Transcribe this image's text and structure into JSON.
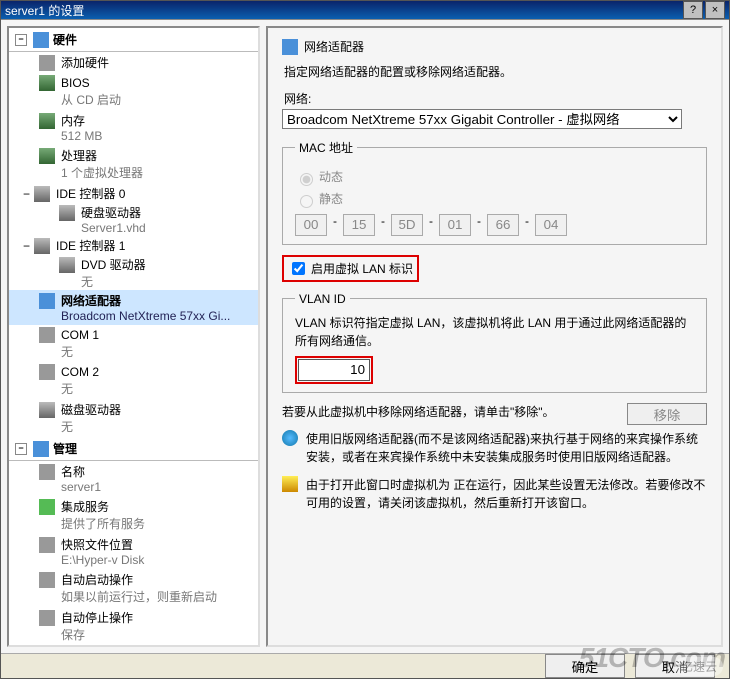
{
  "window": {
    "title": "server1 的设置"
  },
  "titlebar_buttons": {
    "help": "?",
    "close": "×"
  },
  "sections": {
    "hardware": "硬件",
    "management": "管理"
  },
  "hw_items": [
    {
      "label": "添加硬件",
      "sub": ""
    },
    {
      "label": "BIOS",
      "sub": "从 CD 启动"
    },
    {
      "label": "内存",
      "sub": "512 MB"
    },
    {
      "label": "处理器",
      "sub": "1 个虚拟处理器"
    },
    {
      "label": "IDE 控制器 0",
      "sub": "",
      "expandable": true,
      "child": {
        "label": "硬盘驱动器",
        "sub": "Server1.vhd"
      }
    },
    {
      "label": "IDE 控制器 1",
      "sub": "",
      "expandable": true,
      "child": {
        "label": "DVD 驱动器",
        "sub": "无"
      }
    },
    {
      "label": "网络适配器",
      "sub": "Broadcom NetXtreme 57xx Gi...",
      "selected": true
    },
    {
      "label": "COM 1",
      "sub": "无"
    },
    {
      "label": "COM 2",
      "sub": "无"
    },
    {
      "label": "磁盘驱动器",
      "sub": "无"
    }
  ],
  "mgmt_items": [
    {
      "label": "名称",
      "sub": "server1"
    },
    {
      "label": "集成服务",
      "sub": "提供了所有服务"
    },
    {
      "label": "快照文件位置",
      "sub": "E:\\Hyper-v Disk"
    },
    {
      "label": "自动启动操作",
      "sub": "如果以前运行过，则重新启动"
    },
    {
      "label": "自动停止操作",
      "sub": "保存"
    }
  ],
  "panel": {
    "title": "网络适配器",
    "desc": "指定网络适配器的配置或移除网络适配器。",
    "net_label": "网络:",
    "net_value": "Broadcom NetXtreme 57xx Gigabit Controller - 虚拟网络",
    "mac_legend": "MAC 地址",
    "mac_dynamic": "动态",
    "mac_static": "静态",
    "mac": [
      "00",
      "15",
      "5D",
      "01",
      "66",
      "04"
    ],
    "vlan_enable": "启用虚拟 LAN 标识",
    "vlan_legend": "VLAN ID",
    "vlan_desc": "VLAN 标识符指定虚拟 LAN，该虚拟机将此 LAN 用于通过此网络适配器的所有网络通信。",
    "vlan_value": "10",
    "remove_desc": "若要从此虚拟机中移除网络适配器，请单击\"移除\"。",
    "remove_btn": "移除",
    "info_msg": "使用旧版网络适配器(而不是该网络适配器)来执行基于网络的来宾操作系统安装，或者在来宾操作系统中未安装集成服务时使用旧版网络适配器。",
    "warn_msg": "由于打开此窗口时虚拟机为 正在运行，因此某些设置无法修改。若要修改不可用的设置，请关闭该虚拟机，然后重新打开该窗口。"
  },
  "footer": {
    "ok": "确定",
    "cancel": "取消"
  },
  "watermark": {
    "main": "51CTO.com",
    "sub": "亿速云"
  }
}
